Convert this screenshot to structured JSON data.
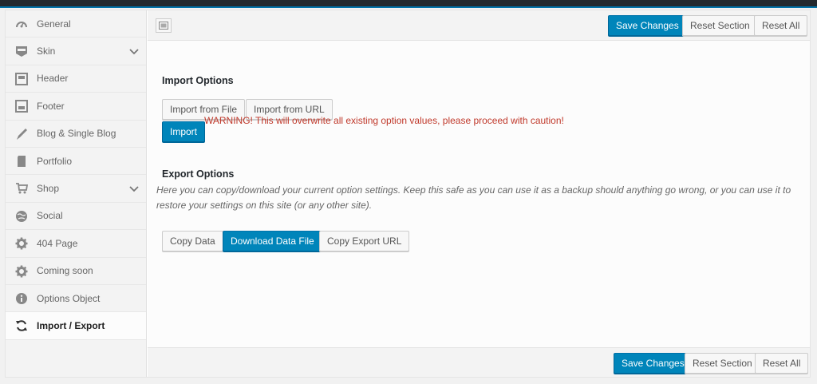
{
  "colors": {
    "accent": "#0085ba",
    "warning": "#c0392b",
    "topbar": "#23282d"
  },
  "sidebar": {
    "items": [
      {
        "label": "General",
        "icon": "speedometer-icon",
        "expandable": false,
        "active": false
      },
      {
        "label": "Skin",
        "icon": "css-icon",
        "expandable": true,
        "active": false
      },
      {
        "label": "Header",
        "icon": "header-layout-icon",
        "expandable": false,
        "active": false
      },
      {
        "label": "Footer",
        "icon": "footer-layout-icon",
        "expandable": false,
        "active": false
      },
      {
        "label": "Blog & Single Blog",
        "icon": "pencil-icon",
        "expandable": false,
        "active": false
      },
      {
        "label": "Portfolio",
        "icon": "document-icon",
        "expandable": false,
        "active": false
      },
      {
        "label": "Shop",
        "icon": "cart-icon",
        "expandable": true,
        "active": false
      },
      {
        "label": "Social",
        "icon": "globe-icon",
        "expandable": false,
        "active": false
      },
      {
        "label": "404 Page",
        "icon": "gear-icon",
        "expandable": false,
        "active": false
      },
      {
        "label": "Coming soon",
        "icon": "gear-icon",
        "expandable": false,
        "active": false
      },
      {
        "label": "Options Object",
        "icon": "info-icon",
        "expandable": false,
        "active": false
      },
      {
        "label": "Import / Export",
        "icon": "refresh-icon",
        "expandable": false,
        "active": true
      }
    ]
  },
  "toolbar": {
    "layout_toggle_icon": "layout-toggle-icon",
    "save_label": "Save Changes",
    "reset_section_label": "Reset Section",
    "reset_all_label": "Reset All"
  },
  "import": {
    "heading": "Import Options",
    "from_file_label": "Import from File",
    "from_url_label": "Import from URL",
    "import_label": "Import",
    "warning": "WARNING! This will overwrite all existing option values, please proceed with caution!"
  },
  "export": {
    "heading": "Export Options",
    "description": "Here you can copy/download your current option settings. Keep this safe as you can use it as a backup should anything go wrong, or you can use it to restore your settings on this site (or any other site).",
    "copy_data_label": "Copy Data",
    "download_label": "Download Data File",
    "copy_url_label": "Copy Export URL"
  },
  "footer": {
    "save_label": "Save Changes",
    "reset_section_label": "Reset Section",
    "reset_all_label": "Reset All"
  }
}
